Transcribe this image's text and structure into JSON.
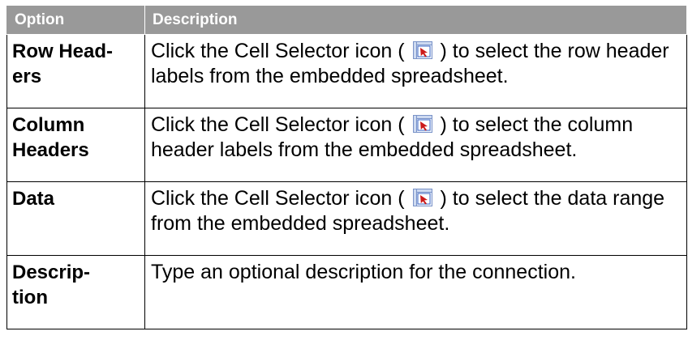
{
  "table": {
    "headers": [
      "Option",
      "Description"
    ],
    "rows": [
      {
        "option": "Row Head-ers",
        "option_line1": "Row Head-",
        "option_line2": "ers",
        "desc_before": "Click the Cell Selector icon ( ",
        "desc_icon": "cell-selector-icon",
        "desc_after": " ) to select the row header labels from the embedded spreadsheet."
      },
      {
        "option": "Column Headers",
        "option_line1": "Column",
        "option_line2": "Headers",
        "desc_before": "Click the Cell Selector icon ( ",
        "desc_icon": "cell-selector-icon",
        "desc_after": " ) to select the column header labels from the embedded spreadsheet."
      },
      {
        "option": "Data",
        "option_line1": "Data",
        "option_line2": "",
        "desc_before": "Click the Cell Selector icon ( ",
        "desc_icon": "cell-selector-icon",
        "desc_after": " ) to select the data range from the embedded spreadsheet."
      },
      {
        "option": "Descrip-tion",
        "option_line1": "Descrip-",
        "option_line2": "tion",
        "desc_before": "Type an optional description for the connection.",
        "desc_icon": "",
        "desc_after": ""
      }
    ]
  },
  "colors": {
    "header_bg": "#999999",
    "header_text": "#ffffff",
    "border": "#000000",
    "icon_red": "#cc1a1a",
    "icon_blue": "#3a66c4"
  }
}
